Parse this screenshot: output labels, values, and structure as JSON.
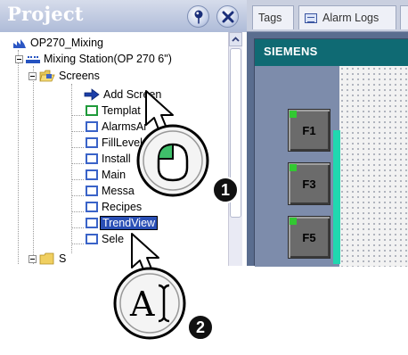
{
  "project_pane": {
    "title": "Project",
    "pin_icon": "pin-icon",
    "close_icon": "close-icon"
  },
  "tree": {
    "root": "OP270_Mixing",
    "station": "Mixing Station(OP 270 6\")",
    "screens_folder": "Screens",
    "items": [
      {
        "label": "Add Screen",
        "icon": "add-screen-icon"
      },
      {
        "label": "Templat",
        "icon": "template-screen-icon"
      },
      {
        "label": "AlarmsAr",
        "icon": "screen-icon"
      },
      {
        "label": "FillLevel",
        "icon": "screen-icon"
      },
      {
        "label": "Install",
        "icon": "screen-icon"
      },
      {
        "label": "Main",
        "icon": "screen-icon"
      },
      {
        "label": "Messa",
        "icon": "screen-icon"
      },
      {
        "label": "Recipes",
        "icon": "screen-icon"
      },
      {
        "label": "TrendView",
        "icon": "screen-icon",
        "state": "editing"
      },
      {
        "label": "Sele",
        "icon": "screen-icon"
      }
    ],
    "next_folder": "S"
  },
  "workspace": {
    "tabs": [
      "Tags",
      "Alarm Logs"
    ],
    "brand": "SIEMENS",
    "function_keys": [
      "F1",
      "F3",
      "F5"
    ]
  },
  "callouts": [
    {
      "number": "1",
      "icon": "mouse-icon",
      "meaning": "click"
    },
    {
      "number": "2",
      "icon": "text-cursor-icon",
      "meaning": "type"
    }
  ],
  "colors": {
    "header_blue": "#aebbd8",
    "selection_blue": "#2a4fb5",
    "panel_teal": "#0f6a73",
    "accent_green": "#20d8b0"
  }
}
